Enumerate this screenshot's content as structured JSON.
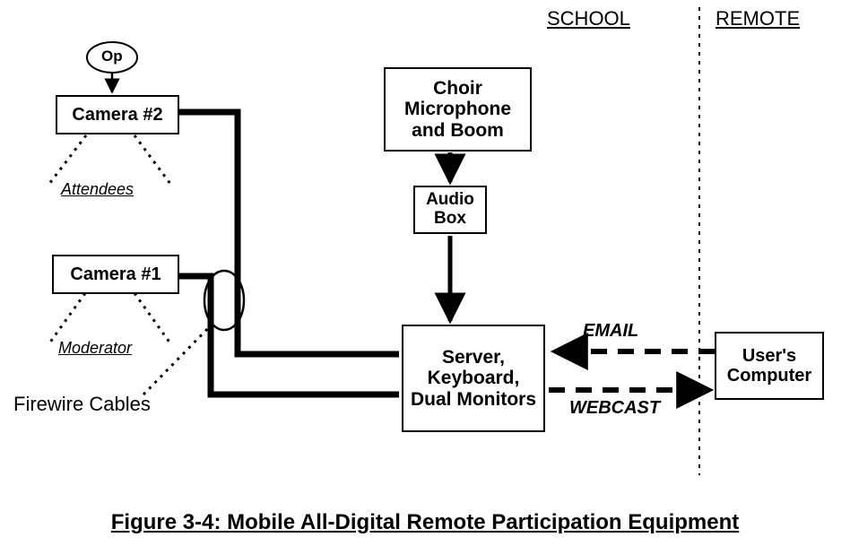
{
  "header": {
    "school": "SCHOOL",
    "remote": "REMOTE"
  },
  "nodes": {
    "op": "Op",
    "camera2": "Camera #2",
    "camera1": "Camera #1",
    "attendees": "Attendees",
    "moderator": "Moderator",
    "firewire": "Firewire Cables",
    "choir_mic": "Choir\nMicrophone\nand Boom",
    "audio_box": "Audio\nBox",
    "server": "Server,\nKeyboard,\nDual\nMonitors",
    "user_computer": "User's\nComputer"
  },
  "edges": {
    "email": "EMAIL",
    "webcast": "WEBCAST"
  },
  "caption": "Figure 3-4: Mobile All-Digital Remote Participation Equipment"
}
